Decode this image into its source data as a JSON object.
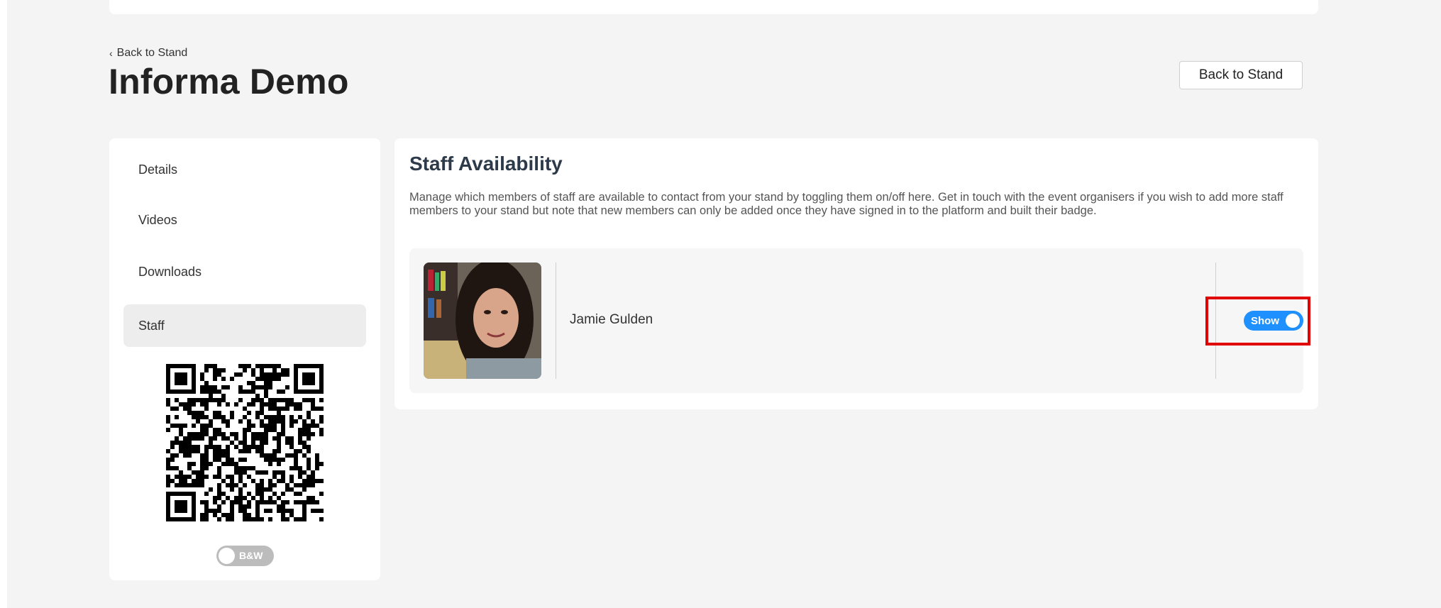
{
  "header": {
    "back_link": "Back to Stand",
    "title": "Informa Demo",
    "back_button": "Back to Stand"
  },
  "sidebar": {
    "items": [
      {
        "label": "Details",
        "active": false
      },
      {
        "label": "Videos",
        "active": false
      },
      {
        "label": "Downloads",
        "active": false
      },
      {
        "label": "Staff",
        "active": true
      }
    ],
    "bw_toggle_label": "B&W",
    "bw_toggle_on": false
  },
  "main": {
    "title": "Staff Availability",
    "description": "Manage which members of staff are available to contact from your stand by toggling them on/off here. Get in touch with the event organisers if you wish to add more staff members to your stand but note that new members can only be added once they have signed in to the platform and built their badge.",
    "staff": [
      {
        "name": "Jamie Gulden",
        "toggle_label": "Show",
        "visible": true
      }
    ]
  },
  "colors": {
    "accent": "#1e90ff",
    "highlight": "#e00000",
    "background": "#f4f4f4"
  }
}
